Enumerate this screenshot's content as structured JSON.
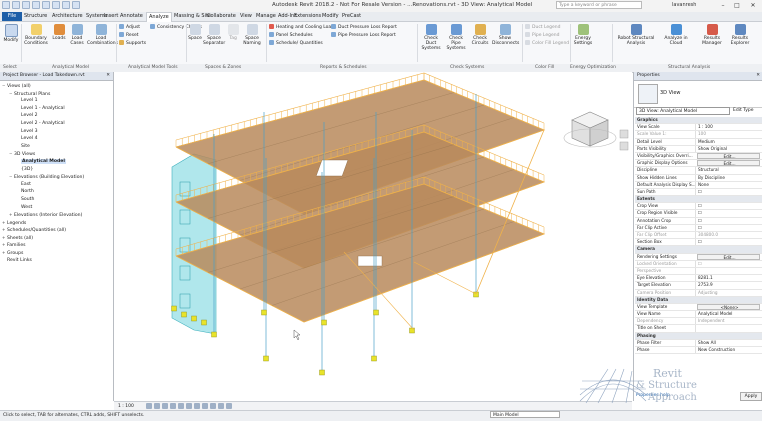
{
  "app": {
    "title": "Autodesk Revit 2018.2 - Not For Resale Version -  ...Renovations.rvt - 3D View: Analytical Model",
    "search_placeholder": "Type a keyword or phrase",
    "user": "lavanresh"
  },
  "tabs": [
    "File",
    "Structure",
    "Architecture",
    "Systems",
    "Insert",
    "Annotate",
    "Analyze",
    "Massing & Site",
    "Collaborate",
    "View",
    "Manage",
    "Add-Ins",
    "Extensions",
    "Modify",
    "PreCast"
  ],
  "active_tab": "Analyze",
  "ribbon": {
    "modify": "Modify",
    "boundary_conditions": "Boundary Conditions",
    "loads": "Loads",
    "load_cases": "Load Cases",
    "load_combinations": "Load Combinations",
    "adjust": "Adjust",
    "reset": "Reset",
    "supports": "Supports",
    "consistency": "Consistency Checks",
    "space": "Space",
    "space_separator": "Space Separator",
    "space_tag": "Tag",
    "space_naming": "Space Naming",
    "heating_cooling": "Heating and Cooling Loads",
    "panel_schedules": "Panel Schedules",
    "schedule_quantities": "Schedule/ Quantities",
    "duct_pressure": "Duct Pressure Loss Report",
    "pipe_pressure": "Pipe Pressure Loss Report",
    "check_duct": "Check Duct Systems",
    "check_pipe": "Check Pipe Systems",
    "check_circuits": "Check Circuits",
    "show_disconnects": "Show Disconnects",
    "duct_legend": "Duct Legend",
    "pipe_legend": "Pipe Legend",
    "color_fill_legend": "Color Fill Legend",
    "energy_settings": "Energy Settings",
    "robot": "Robot Structural Analysis",
    "analyze_cloud": "Analyze in Cloud",
    "results_manager": "Results Manager",
    "results_explorer": "Results Explorer"
  },
  "ribbon_groups": [
    "Select",
    "Analytical Model",
    "Analytical Model Tools",
    "Spaces & Zones",
    "Reports & Schedules",
    "Check Systems",
    "Color Fill",
    "Energy Optimization",
    "Structural Analysis"
  ],
  "project_browser": {
    "title": "Project Browser - Load Takedown.rvt",
    "items": [
      {
        "label": "Views (all)",
        "level": 0,
        "toggle": "−"
      },
      {
        "label": "Structural Plans",
        "level": 1,
        "toggle": "−"
      },
      {
        "label": "Level 1",
        "level": 2,
        "toggle": ""
      },
      {
        "label": "Level 1 - Analytical",
        "level": 2,
        "toggle": ""
      },
      {
        "label": "Level 2",
        "level": 2,
        "toggle": ""
      },
      {
        "label": "Level 2 - Analytical",
        "level": 2,
        "toggle": ""
      },
      {
        "label": "Level 3",
        "level": 2,
        "toggle": ""
      },
      {
        "label": "Level 4",
        "level": 2,
        "toggle": ""
      },
      {
        "label": "Site",
        "level": 2,
        "toggle": ""
      },
      {
        "label": "3D Views",
        "level": 1,
        "toggle": "−"
      },
      {
        "label": "Analytical Model",
        "level": 2,
        "toggle": "",
        "selected": true
      },
      {
        "label": "{3D}",
        "level": 2,
        "toggle": ""
      },
      {
        "label": "Elevations (Building Elevation)",
        "level": 1,
        "toggle": "−"
      },
      {
        "label": "East",
        "level": 2,
        "toggle": ""
      },
      {
        "label": "North",
        "level": 2,
        "toggle": ""
      },
      {
        "label": "South",
        "level": 2,
        "toggle": ""
      },
      {
        "label": "West",
        "level": 2,
        "toggle": ""
      },
      {
        "label": "Elevations (Interior Elevation)",
        "level": 1,
        "toggle": "+"
      },
      {
        "label": "Legends",
        "level": 0,
        "toggle": "+"
      },
      {
        "label": "Schedules/Quantities (all)",
        "level": 0,
        "toggle": "+"
      },
      {
        "label": "Sheets (all)",
        "level": 0,
        "toggle": "+"
      },
      {
        "label": "Families",
        "level": 0,
        "toggle": "+"
      },
      {
        "label": "Groups",
        "level": 0,
        "toggle": "+"
      },
      {
        "label": "Revit Links",
        "level": 0,
        "toggle": ""
      }
    ]
  },
  "properties": {
    "title": "Properties",
    "type_name": "3D View",
    "view_select": "3D View: Analytical Model",
    "edit_type": "Edit Type",
    "rows": [
      {
        "k": "Graphics",
        "cat": true
      },
      {
        "k": "View Scale",
        "v": "1 : 100"
      },
      {
        "k": "Scale Value  1:",
        "v": "100",
        "dim": true
      },
      {
        "k": "Detail Level",
        "v": "Medium"
      },
      {
        "k": "Parts Visibility",
        "v": "Show Original"
      },
      {
        "k": "Visibility/Graphics Overri...",
        "v": "Edit...",
        "btn": true
      },
      {
        "k": "Graphic Display Options",
        "v": "Edit...",
        "btn": true
      },
      {
        "k": "Discipline",
        "v": "Structural"
      },
      {
        "k": "Show Hidden Lines",
        "v": "By Discipline"
      },
      {
        "k": "Default Analysis Display S...",
        "v": "None"
      },
      {
        "k": "Sun Path",
        "v": "☐"
      },
      {
        "k": "Extents",
        "cat": true
      },
      {
        "k": "Crop View",
        "v": "☐"
      },
      {
        "k": "Crop Region Visible",
        "v": "☐"
      },
      {
        "k": "Annotation Crop",
        "v": "☐"
      },
      {
        "k": "Far Clip Active",
        "v": "☐"
      },
      {
        "k": "Far Clip Offset",
        "v": "304800.0",
        "dim": true
      },
      {
        "k": "Section Box",
        "v": "☐"
      },
      {
        "k": "Camera",
        "cat": true
      },
      {
        "k": "Rendering Settings",
        "v": "Edit...",
        "btn": true
      },
      {
        "k": "Locked Orientation",
        "v": "☐",
        "dim": true
      },
      {
        "k": "Perspective",
        "v": "",
        "dim": true
      },
      {
        "k": "Eye Elevation",
        "v": "8281.1"
      },
      {
        "k": "Target Elevation",
        "v": "2753.9"
      },
      {
        "k": "Camera Position",
        "v": "Adjusting",
        "dim": true
      },
      {
        "k": "Identity Data",
        "cat": true
      },
      {
        "k": "View Template",
        "v": "<None>",
        "btn": true
      },
      {
        "k": "View Name",
        "v": "Analytical Model"
      },
      {
        "k": "Dependency",
        "v": "Independent",
        "dim": true
      },
      {
        "k": "Title on Sheet",
        "v": ""
      },
      {
        "k": "Phasing",
        "cat": true
      },
      {
        "k": "Phase Filter",
        "v": "Show All"
      },
      {
        "k": "Phase",
        "v": "New Construction"
      }
    ],
    "help": "Properties help",
    "apply": "Apply"
  },
  "view_control": {
    "scale": "1 : 100"
  },
  "status": {
    "message": "Click to select, TAB for alternates, CTRL adds, SHIFT unselects.",
    "model": "Main Model"
  },
  "watermark": {
    "line1": "Revit",
    "line2": "& Structure",
    "line3": "Approach"
  },
  "colors": {
    "accent": "#1e5fa8",
    "slab": "#b98a5c",
    "beam": "#f0b24a",
    "wall": "#6fd3dc",
    "node": "#e8e32a"
  }
}
